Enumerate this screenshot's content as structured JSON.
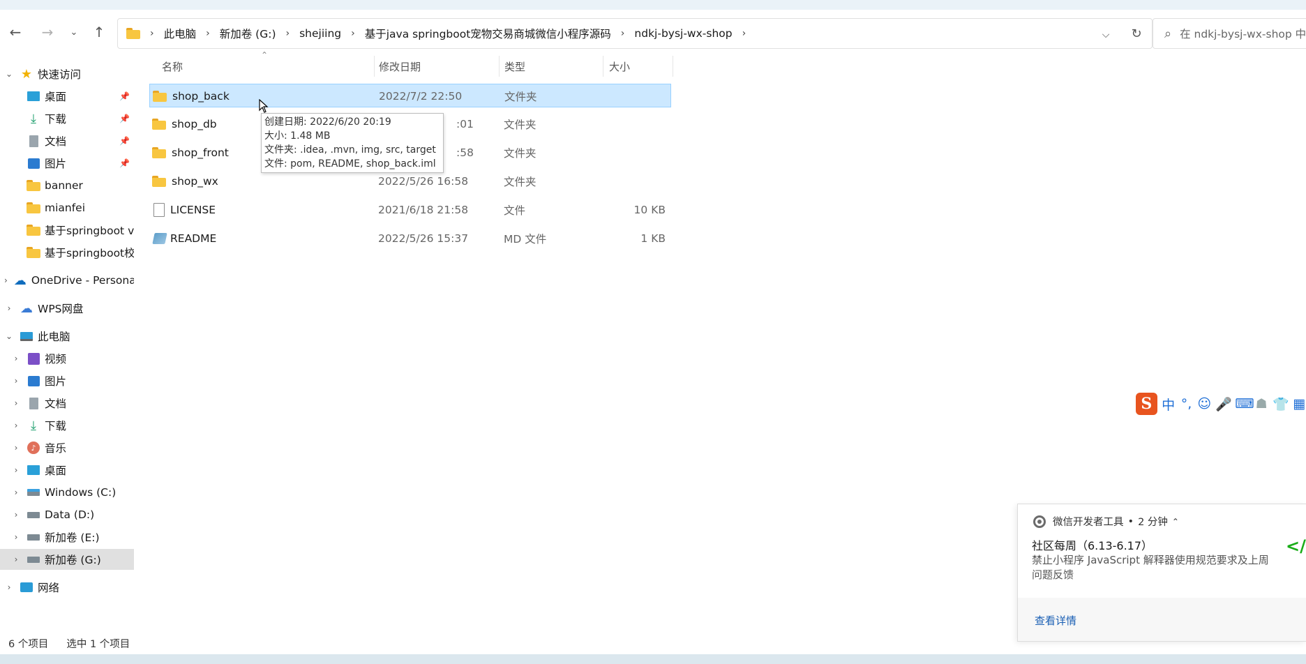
{
  "address": {
    "crumbs": [
      "此电脑",
      "新加卷 (G:)",
      "shejiing",
      "基于java springboot宠物交易商城微信小程序源码",
      "ndkj-bysj-wx-shop"
    ],
    "search_placeholder": "在 ndkj-bysj-wx-shop 中"
  },
  "sidebar": {
    "quick_access": "快速访问",
    "quick_items": [
      "桌面",
      "下载",
      "文档",
      "图片",
      "banner",
      "mianfei",
      "基于springboot vu",
      "基于springboot校"
    ],
    "onedrive": "OneDrive - Persona",
    "wps": "WPS网盘",
    "this_pc": "此电脑",
    "pc_items": [
      "视频",
      "图片",
      "文档",
      "下载",
      "音乐",
      "桌面",
      "Windows (C:)",
      "Data (D:)",
      "新加卷 (E:)",
      "新加卷 (G:)"
    ],
    "network": "网络"
  },
  "columns": {
    "name": "名称",
    "date": "修改日期",
    "type": "类型",
    "size": "大小"
  },
  "files": [
    {
      "name": "shop_back",
      "date": "2022/7/2 22:50",
      "type": "文件夹",
      "size": ""
    },
    {
      "name": "shop_db",
      "date": ":01",
      "type": "文件夹",
      "size": ""
    },
    {
      "name": "shop_front",
      "date": ":58",
      "type": "文件夹",
      "size": ""
    },
    {
      "name": "shop_wx",
      "date": "2022/5/26 16:58",
      "type": "文件夹",
      "size": ""
    },
    {
      "name": "LICENSE",
      "date": "2021/6/18 21:58",
      "type": "文件",
      "size": "10 KB"
    },
    {
      "name": "README",
      "date": "2022/5/26 15:37",
      "type": "MD 文件",
      "size": "1 KB"
    }
  ],
  "tooltip": {
    "created": "创建日期: 2022/6/20 20:19",
    "size": "大小: 1.48 MB",
    "folders": "文件夹: .idea, .mvn, img, src, target",
    "files": "文件: pom, README, shop_back.iml"
  },
  "status": {
    "count": "6 个项目",
    "selected": "选中 1 个项目"
  },
  "ime": {
    "mode": "中",
    "punct": "°,"
  },
  "notification": {
    "app": "微信开发者工具",
    "time": "2 分钟",
    "title": "社区每周（6.13-6.17）",
    "body": "禁止小程序 JavaScript 解释器使用规范要求及上周问题反馈",
    "link": "查看详情",
    "code_icon": "</"
  }
}
